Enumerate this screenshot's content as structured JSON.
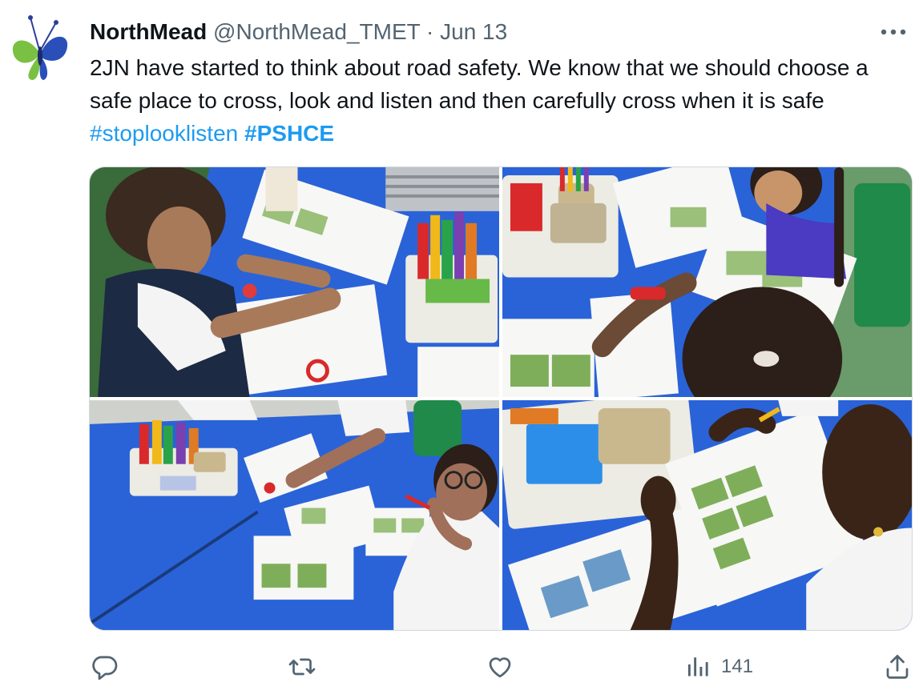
{
  "tweet": {
    "author_name": "NorthMead",
    "handle": "@NorthMead_TMET",
    "separator": "·",
    "date": "Jun 13",
    "text_plain": "2JN have started to think about road safety. We know that we should choose a safe place to cross, look and listen and then carefully cross when it is safe",
    "hashtags": [
      "#stoplooklisten",
      "#PSHCE"
    ]
  },
  "photos": [
    {
      "label": "Photo 1"
    },
    {
      "label": "Photo 2"
    },
    {
      "label": "Photo 3"
    },
    {
      "label": "Photo 4"
    }
  ],
  "actions": {
    "reply_icon": "reply-icon",
    "retweet_icon": "retweet-icon",
    "like_icon": "heart-icon",
    "views_icon": "views-icon",
    "views_count": "141",
    "share_icon": "share-icon"
  },
  "colors": {
    "accent": "#1d9bf0",
    "text": "#0f1419",
    "muted": "#536471",
    "table_blue": "#1f5fd0"
  }
}
